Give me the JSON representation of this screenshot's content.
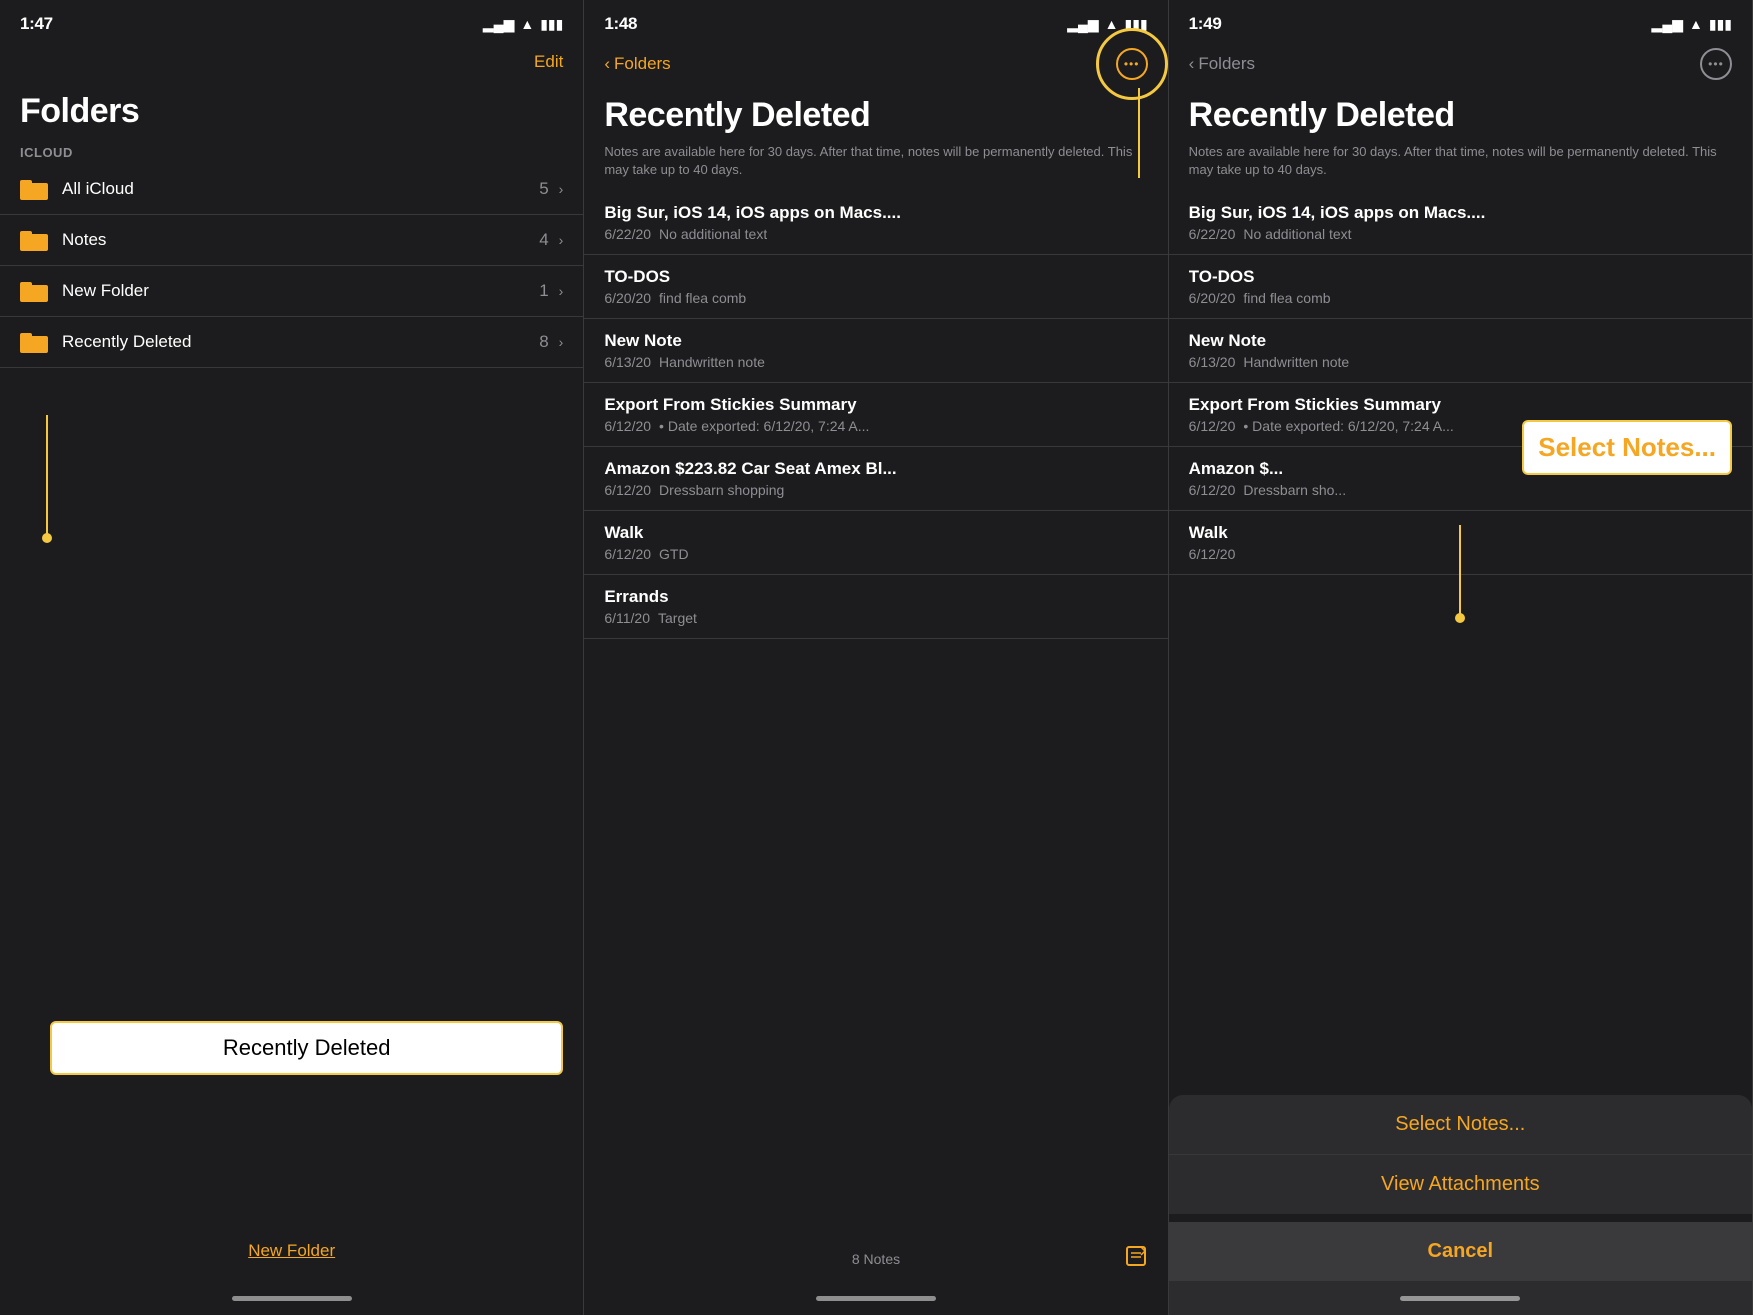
{
  "panel1": {
    "status_time": "1:47",
    "status_arrow": "↗",
    "nav_edit": "Edit",
    "page_title": "Folders",
    "section_label": "ICLOUD",
    "folders": [
      {
        "name": "All iCloud",
        "count": "5"
      },
      {
        "name": "Notes",
        "count": "4"
      },
      {
        "name": "New Folder",
        "count": "1"
      },
      {
        "name": "Recently Deleted",
        "count": "8"
      }
    ],
    "new_folder_link": "New Folder",
    "callout_text": "Recently Deleted"
  },
  "panel2": {
    "status_time": "1:48",
    "status_arrow": "↗",
    "nav_back": "Folders",
    "page_title": "Recently Deleted",
    "page_subtitle": "Notes are available here for 30 days. After that time, notes will be permanently deleted. This may take up to 40 days.",
    "notes": [
      {
        "title": "Big Sur, iOS 14, iOS apps on Macs....",
        "date": "6/22/20",
        "preview": "No additional text"
      },
      {
        "title": "TO-DOS",
        "date": "6/20/20",
        "preview": "find flea comb"
      },
      {
        "title": "New Note",
        "date": "6/13/20",
        "preview": "Handwritten note"
      },
      {
        "title": "Export From Stickies Summary",
        "date": "6/12/20",
        "preview": "• Date exported: 6/12/20, 7:24 A..."
      },
      {
        "title": "Amazon $223.82 Car Seat Amex Bl...",
        "date": "6/12/20",
        "preview": "Dressbarn shopping"
      },
      {
        "title": "Walk",
        "date": "6/12/20",
        "preview": "GTD"
      },
      {
        "title": "Errands",
        "date": "6/11/20",
        "preview": "Target"
      }
    ],
    "notes_count": "8 Notes"
  },
  "panel3": {
    "status_time": "1:49",
    "status_arrow": "↗",
    "nav_back": "Folders",
    "page_title": "Recently Deleted",
    "page_subtitle": "Notes are available here for 30 days. After that time, notes will be permanently deleted. This may take up to 40 days.",
    "notes": [
      {
        "title": "Big Sur, iOS 14, iOS apps on Macs....",
        "date": "6/22/20",
        "preview": "No additional text"
      },
      {
        "title": "TO-DOS",
        "date": "6/20/20",
        "preview": "find flea comb"
      },
      {
        "title": "New Note",
        "date": "6/13/20",
        "preview": "Handwritten note"
      },
      {
        "title": "Export From Stickies Summary",
        "date": "6/12/20",
        "preview": "• Date exported: 6/12/20, 7:24 A..."
      },
      {
        "title": "Amazon $...",
        "date": "6/12/20",
        "preview": "Dressbarn sho..."
      },
      {
        "title": "Walk",
        "date": "6/12/20",
        "preview": ""
      }
    ],
    "action_sheet": {
      "select_notes": "Select Notes...",
      "view_attachments": "View Attachments",
      "cancel": "Cancel"
    },
    "callout_label": "Select Notes..."
  },
  "icons": {
    "chevron_right": "›",
    "chevron_left": "‹",
    "ellipsis": "•••",
    "compose": "⎘",
    "signal": "▂▄▆",
    "wifi": "📶",
    "battery": "🔋"
  }
}
